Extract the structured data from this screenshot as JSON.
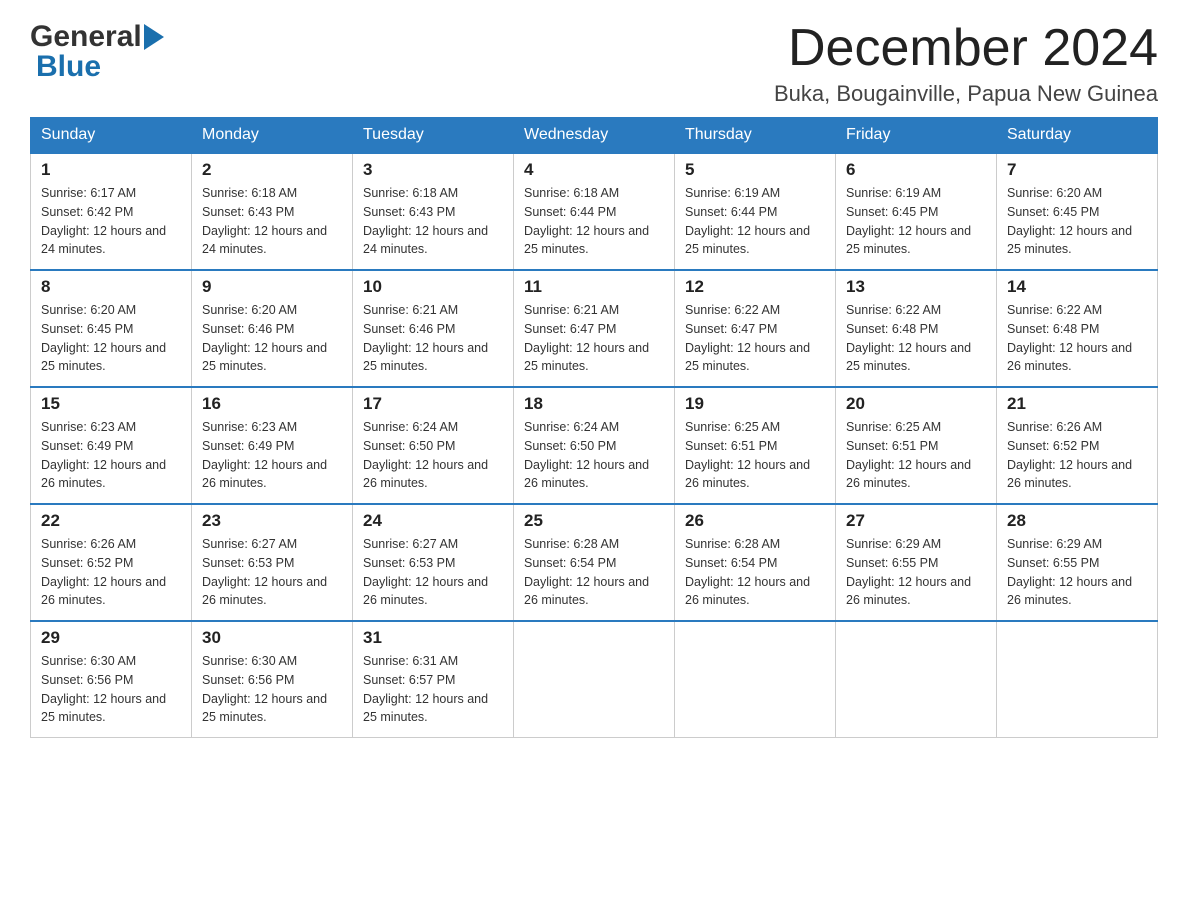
{
  "header": {
    "logo_general": "General",
    "logo_blue": "Blue",
    "month_year": "December 2024",
    "location": "Buka, Bougainville, Papua New Guinea"
  },
  "calendar": {
    "days_of_week": [
      "Sunday",
      "Monday",
      "Tuesday",
      "Wednesday",
      "Thursday",
      "Friday",
      "Saturday"
    ],
    "weeks": [
      [
        {
          "day": "1",
          "sunrise": "6:17 AM",
          "sunset": "6:42 PM",
          "daylight": "12 hours and 24 minutes."
        },
        {
          "day": "2",
          "sunrise": "6:18 AM",
          "sunset": "6:43 PM",
          "daylight": "12 hours and 24 minutes."
        },
        {
          "day": "3",
          "sunrise": "6:18 AM",
          "sunset": "6:43 PM",
          "daylight": "12 hours and 24 minutes."
        },
        {
          "day": "4",
          "sunrise": "6:18 AM",
          "sunset": "6:44 PM",
          "daylight": "12 hours and 25 minutes."
        },
        {
          "day": "5",
          "sunrise": "6:19 AM",
          "sunset": "6:44 PM",
          "daylight": "12 hours and 25 minutes."
        },
        {
          "day": "6",
          "sunrise": "6:19 AM",
          "sunset": "6:45 PM",
          "daylight": "12 hours and 25 minutes."
        },
        {
          "day": "7",
          "sunrise": "6:20 AM",
          "sunset": "6:45 PM",
          "daylight": "12 hours and 25 minutes."
        }
      ],
      [
        {
          "day": "8",
          "sunrise": "6:20 AM",
          "sunset": "6:45 PM",
          "daylight": "12 hours and 25 minutes."
        },
        {
          "day": "9",
          "sunrise": "6:20 AM",
          "sunset": "6:46 PM",
          "daylight": "12 hours and 25 minutes."
        },
        {
          "day": "10",
          "sunrise": "6:21 AM",
          "sunset": "6:46 PM",
          "daylight": "12 hours and 25 minutes."
        },
        {
          "day": "11",
          "sunrise": "6:21 AM",
          "sunset": "6:47 PM",
          "daylight": "12 hours and 25 minutes."
        },
        {
          "day": "12",
          "sunrise": "6:22 AM",
          "sunset": "6:47 PM",
          "daylight": "12 hours and 25 minutes."
        },
        {
          "day": "13",
          "sunrise": "6:22 AM",
          "sunset": "6:48 PM",
          "daylight": "12 hours and 25 minutes."
        },
        {
          "day": "14",
          "sunrise": "6:22 AM",
          "sunset": "6:48 PM",
          "daylight": "12 hours and 26 minutes."
        }
      ],
      [
        {
          "day": "15",
          "sunrise": "6:23 AM",
          "sunset": "6:49 PM",
          "daylight": "12 hours and 26 minutes."
        },
        {
          "day": "16",
          "sunrise": "6:23 AM",
          "sunset": "6:49 PM",
          "daylight": "12 hours and 26 minutes."
        },
        {
          "day": "17",
          "sunrise": "6:24 AM",
          "sunset": "6:50 PM",
          "daylight": "12 hours and 26 minutes."
        },
        {
          "day": "18",
          "sunrise": "6:24 AM",
          "sunset": "6:50 PM",
          "daylight": "12 hours and 26 minutes."
        },
        {
          "day": "19",
          "sunrise": "6:25 AM",
          "sunset": "6:51 PM",
          "daylight": "12 hours and 26 minutes."
        },
        {
          "day": "20",
          "sunrise": "6:25 AM",
          "sunset": "6:51 PM",
          "daylight": "12 hours and 26 minutes."
        },
        {
          "day": "21",
          "sunrise": "6:26 AM",
          "sunset": "6:52 PM",
          "daylight": "12 hours and 26 minutes."
        }
      ],
      [
        {
          "day": "22",
          "sunrise": "6:26 AM",
          "sunset": "6:52 PM",
          "daylight": "12 hours and 26 minutes."
        },
        {
          "day": "23",
          "sunrise": "6:27 AM",
          "sunset": "6:53 PM",
          "daylight": "12 hours and 26 minutes."
        },
        {
          "day": "24",
          "sunrise": "6:27 AM",
          "sunset": "6:53 PM",
          "daylight": "12 hours and 26 minutes."
        },
        {
          "day": "25",
          "sunrise": "6:28 AM",
          "sunset": "6:54 PM",
          "daylight": "12 hours and 26 minutes."
        },
        {
          "day": "26",
          "sunrise": "6:28 AM",
          "sunset": "6:54 PM",
          "daylight": "12 hours and 26 minutes."
        },
        {
          "day": "27",
          "sunrise": "6:29 AM",
          "sunset": "6:55 PM",
          "daylight": "12 hours and 26 minutes."
        },
        {
          "day": "28",
          "sunrise": "6:29 AM",
          "sunset": "6:55 PM",
          "daylight": "12 hours and 26 minutes."
        }
      ],
      [
        {
          "day": "29",
          "sunrise": "6:30 AM",
          "sunset": "6:56 PM",
          "daylight": "12 hours and 25 minutes."
        },
        {
          "day": "30",
          "sunrise": "6:30 AM",
          "sunset": "6:56 PM",
          "daylight": "12 hours and 25 minutes."
        },
        {
          "day": "31",
          "sunrise": "6:31 AM",
          "sunset": "6:57 PM",
          "daylight": "12 hours and 25 minutes."
        },
        null,
        null,
        null,
        null
      ]
    ]
  }
}
